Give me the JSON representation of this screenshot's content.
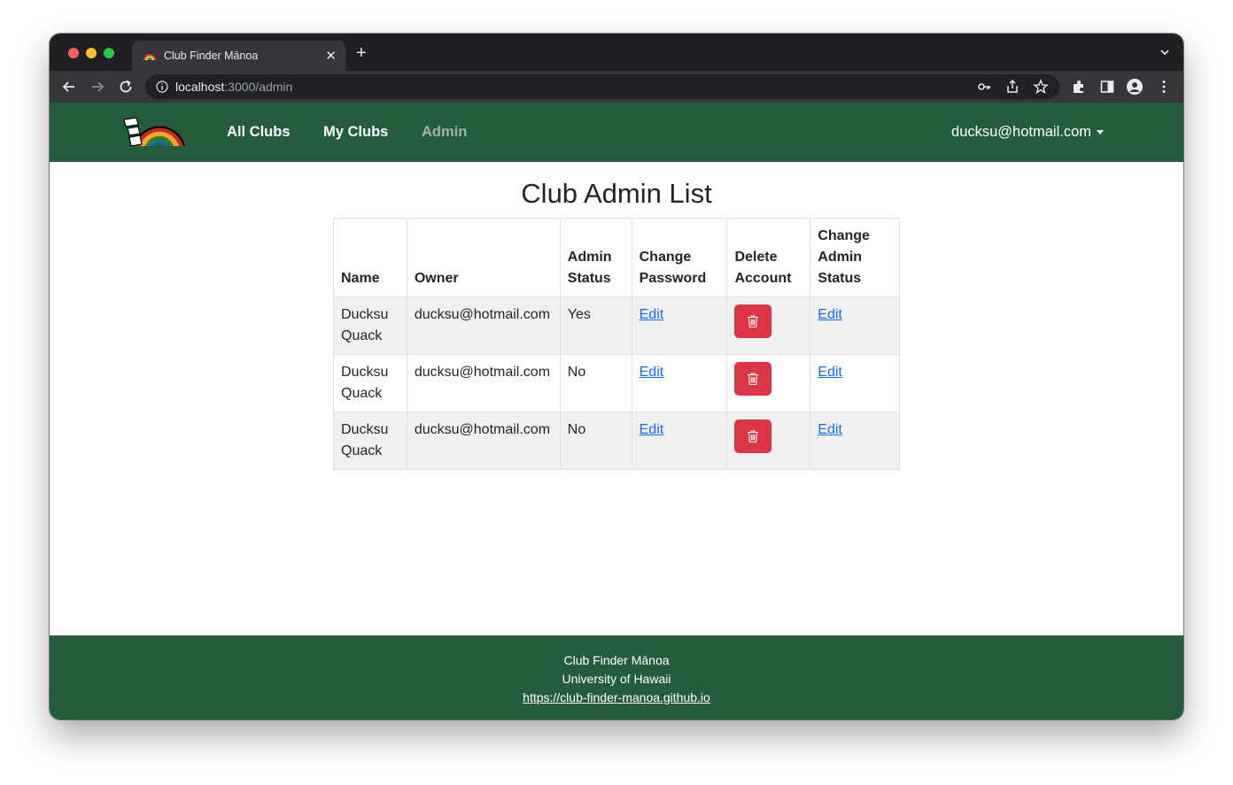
{
  "browser": {
    "tab_title": "Club Finder Mānoa",
    "url_host": "localhost",
    "url_path": ":3000/admin"
  },
  "navbar": {
    "links": [
      "All Clubs",
      "My Clubs",
      "Admin"
    ],
    "active": "Admin",
    "user": "ducksu@hotmail.com"
  },
  "main": {
    "title": "Club Admin List",
    "columns": [
      "Name",
      "Owner",
      "Admin Status",
      "Change Password",
      "Delete Account",
      "Change Admin Status"
    ],
    "rows": [
      {
        "name": "Ducksu Quack",
        "owner": "ducksu@hotmail.com",
        "admin": "Yes",
        "password_link": "Edit",
        "admin_link": "Edit"
      },
      {
        "name": "Ducksu Quack",
        "owner": "ducksu@hotmail.com",
        "admin": "No",
        "password_link": "Edit",
        "admin_link": "Edit"
      },
      {
        "name": "Ducksu Quack",
        "owner": "ducksu@hotmail.com",
        "admin": "No",
        "password_link": "Edit",
        "admin_link": "Edit"
      }
    ]
  },
  "footer": {
    "line1": "Club Finder Mānoa",
    "line2": "University of Hawaii",
    "link": "https://club-finder-manoa.github.io"
  },
  "colors": {
    "nav_bg": "#245c3e",
    "danger": "#dc3545",
    "link": "#0d6efd"
  },
  "icons": [
    "back-icon",
    "forward-icon",
    "reload-icon",
    "info-icon",
    "key-icon",
    "share-icon",
    "star-icon",
    "extensions-icon",
    "sidepanel-icon",
    "profile-icon",
    "kebab-menu-icon",
    "trash-icon"
  ]
}
